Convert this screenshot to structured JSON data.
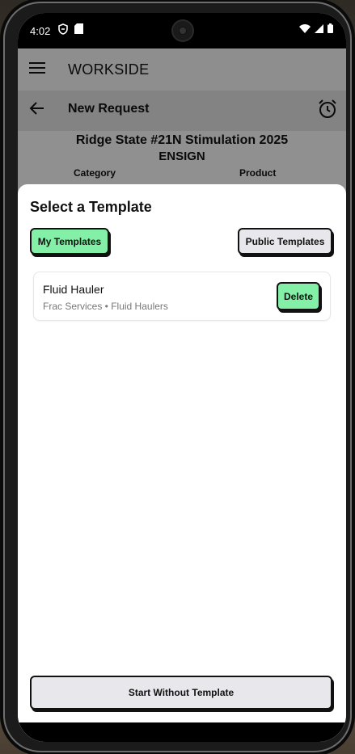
{
  "status_bar": {
    "time": "4:02",
    "left_icons": [
      "shield-icon",
      "sd-card-icon"
    ],
    "right_icons": [
      "wifi-icon",
      "signal-icon",
      "battery-icon"
    ]
  },
  "app_bar": {
    "title": "WORKSIDE",
    "menu_icon": "hamburger-menu-icon"
  },
  "sub_bar": {
    "title": "New Request",
    "back_icon": "arrow-back-icon",
    "alarm_icon": "alarm-clock-icon"
  },
  "request": {
    "title": "Ridge State #21N  Stimulation 2025",
    "company": "ENSIGN",
    "category_label": "Category",
    "product_label": "Product"
  },
  "sheet": {
    "title": "Select a Template",
    "my_templates_label": "My Templates",
    "public_templates_label": "Public Templates",
    "templates": [
      {
        "name": "Fluid Hauler",
        "subtitle": "Frac Services • Fluid Haulers",
        "delete_label": "Delete"
      }
    ],
    "start_without_label": "Start Without Template"
  },
  "colors": {
    "accent_green": "#84f0a7",
    "button_gray": "#e8e8ec",
    "app_bar_bg": "#e6e6e6"
  }
}
